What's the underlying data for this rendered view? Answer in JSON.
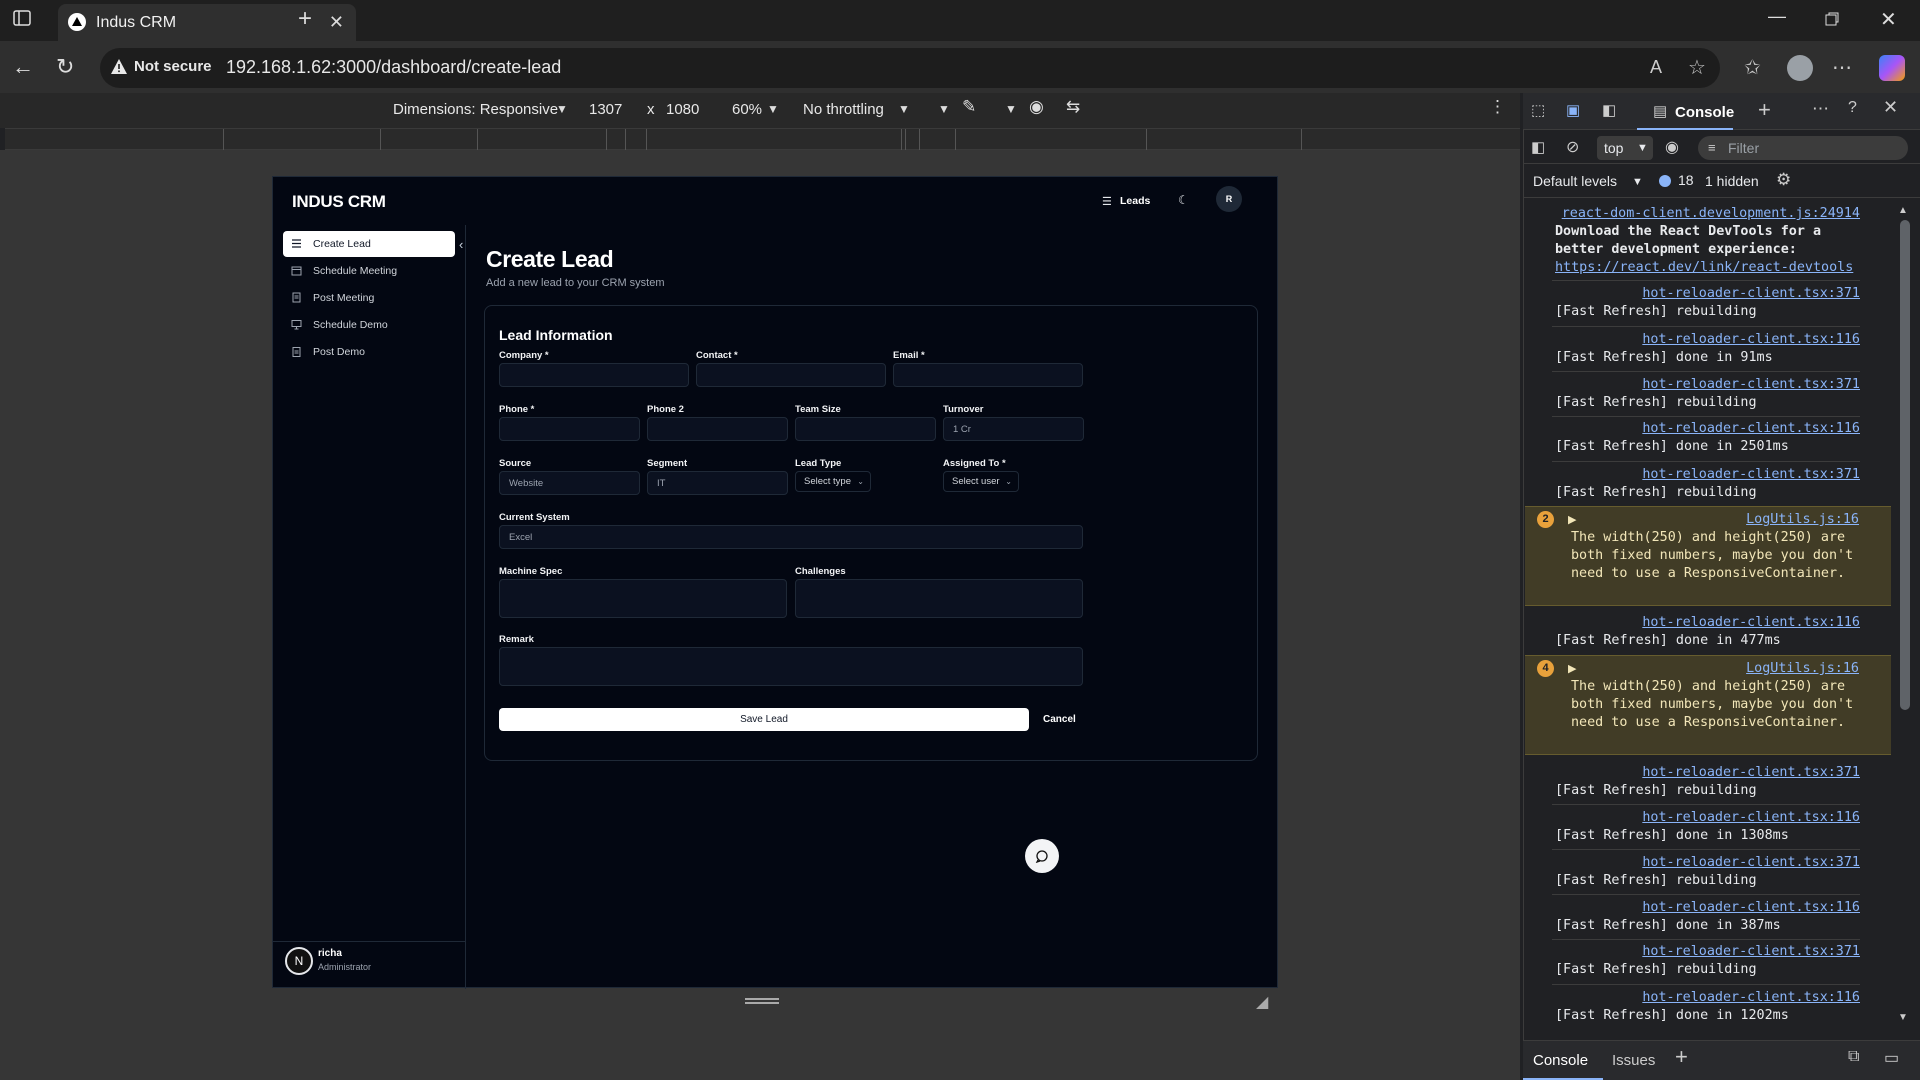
{
  "browser": {
    "tab_title": "Indus CRM",
    "security": "Not secure",
    "url": "192.168.1.62:3000/dashboard/create-lead"
  },
  "device_toolbar": {
    "dimensions_label": "Dimensions: Responsive",
    "width": "1307",
    "times": "x",
    "height": "1080",
    "zoom": "60%",
    "throttling": "No throttling"
  },
  "app": {
    "logo": "INDUS CRM",
    "header_leads": "Leads",
    "header_avatar": "R",
    "nav": [
      {
        "label": "Create Lead",
        "icon": "list-icon"
      },
      {
        "label": "Schedule Meeting",
        "icon": "calendar-icon"
      },
      {
        "label": "Post Meeting",
        "icon": "document-icon"
      },
      {
        "label": "Schedule Demo",
        "icon": "monitor-icon"
      },
      {
        "label": "Post Demo",
        "icon": "clipboard-icon"
      }
    ],
    "user": {
      "initial": "N",
      "name": "richa",
      "role": "Administrator"
    },
    "page_title": "Create Lead",
    "page_subtitle": "Add a new lead to your CRM system",
    "card_title": "Lead Information",
    "fields": {
      "company": {
        "label": "Company *",
        "value": ""
      },
      "contact": {
        "label": "Contact *",
        "value": ""
      },
      "email": {
        "label": "Email *",
        "value": ""
      },
      "phone": {
        "label": "Phone *",
        "value": ""
      },
      "phone2": {
        "label": "Phone 2",
        "value": ""
      },
      "team_size": {
        "label": "Team Size",
        "value": ""
      },
      "turnover": {
        "label": "Turnover",
        "placeholder": "1 Cr"
      },
      "source": {
        "label": "Source",
        "placeholder": "Website"
      },
      "segment": {
        "label": "Segment",
        "placeholder": "IT"
      },
      "lead_type": {
        "label": "Lead Type",
        "selected": "Select type"
      },
      "assigned_to": {
        "label": "Assigned To *",
        "selected": "Select user"
      },
      "current_system": {
        "label": "Current System",
        "placeholder": "Excel"
      },
      "machine_spec": {
        "label": "Machine Spec",
        "value": ""
      },
      "challenges": {
        "label": "Challenges",
        "value": ""
      },
      "remark": {
        "label": "Remark",
        "value": ""
      }
    },
    "save_label": "Save Lead",
    "cancel_label": "Cancel"
  },
  "devtools": {
    "tab_console": "Console",
    "context": "top",
    "filter_placeholder": "Filter",
    "levels": "Default levels",
    "message_count": "18",
    "hidden": "1 hidden",
    "logs": [
      {
        "src": "react-dom-client.development.js:24914",
        "text": "Download the React DevTools for a better development experience:",
        "link": "https://react.dev/link/react-devtools"
      },
      {
        "src": "hot-reloader-client.tsx:371",
        "text": "[Fast Refresh] rebuilding"
      },
      {
        "src": "hot-reloader-client.tsx:116",
        "text": "[Fast Refresh] done in 91ms"
      },
      {
        "src": "hot-reloader-client.tsx:371",
        "text": "[Fast Refresh] rebuilding"
      },
      {
        "src": "hot-reloader-client.tsx:116",
        "text": "[Fast Refresh] done in 2501ms"
      },
      {
        "src": "hot-reloader-client.tsx:371",
        "text": "[Fast Refresh] rebuilding"
      },
      {
        "badge": "2",
        "src": "LogUtils.js:16",
        "text": "The width(250) and height(250) are both fixed numbers, maybe you don't need to use a ResponsiveContainer."
      },
      {
        "src": "hot-reloader-client.tsx:116",
        "text": "[Fast Refresh] done in 477ms"
      },
      {
        "badge": "4",
        "src": "LogUtils.js:16",
        "text": "The width(250) and height(250) are both fixed numbers, maybe you don't need to use a ResponsiveContainer."
      },
      {
        "src": "hot-reloader-client.tsx:371",
        "text": "[Fast Refresh] rebuilding"
      },
      {
        "src": "hot-reloader-client.tsx:116",
        "text": "[Fast Refresh] done in 1308ms"
      },
      {
        "src": "hot-reloader-client.tsx:371",
        "text": "[Fast Refresh] rebuilding"
      },
      {
        "src": "hot-reloader-client.tsx:116",
        "text": "[Fast Refresh] done in 387ms"
      },
      {
        "src": "hot-reloader-client.tsx:371",
        "text": "[Fast Refresh] rebuilding"
      },
      {
        "src": "hot-reloader-client.tsx:116",
        "text": "[Fast Refresh] done in 1202ms"
      }
    ],
    "bottom_tab_console": "Console",
    "bottom_tab_issues": "Issues"
  }
}
